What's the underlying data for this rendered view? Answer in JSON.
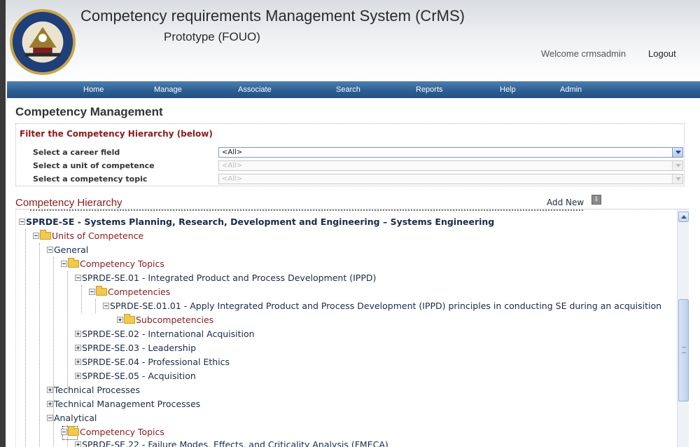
{
  "header": {
    "title": "Competency requirements Management System (CrMS)",
    "subtitle": "Prototype (FOUO)",
    "welcome": "Welcome crmsadmin",
    "logout": "Logout"
  },
  "nav": [
    "Home",
    "Manage",
    "Associate",
    "Search",
    "Reports",
    "Help",
    "Admin"
  ],
  "page": {
    "title": "Competency Management"
  },
  "filter": {
    "title": "Filter the Competency Hierarchy (below)",
    "career_field_label": "Select a career field",
    "career_field_value": "<All>",
    "unit_label": "Select a unit of competence",
    "unit_value": "<All>",
    "topic_label": "Select a competency topic",
    "topic_value": "<All>"
  },
  "hierarchy": {
    "title": "Competency Hierarchy",
    "add_new": "Add New",
    "rows": [
      "SPRDE-SE - Systems Planning, Research, Development and Engineering – Systems Engineering",
      "Units of Competence",
      "General",
      "Competency Topics",
      "SPRDE-SE.01 - Integrated Product and Process Development (IPPD)",
      "Competencies",
      "SPRDE-SE.01.01 - Apply Integrated Product and Process Development (IPPD) principles in conducting SE during an acquisition",
      "Subcompetencies",
      "SPRDE-SE.02 - International Acquisition",
      "SPRDE-SE.03 - Leadership",
      "SPRDE-SE.04 - Professional Ethics",
      "SPRDE-SE.05 - Acquisition",
      "Technical Processes",
      "Technical Management Processes",
      "Analytical",
      "Competency Topics",
      "SPRDE-SE.22 - Failure Modes, Effects, and Criticality Analysis (FMECA)"
    ]
  },
  "colors": {
    "nav_bg": "#2d5f93",
    "accent_red": "#8b1a1a",
    "link_blue": "#1a2a4a"
  }
}
